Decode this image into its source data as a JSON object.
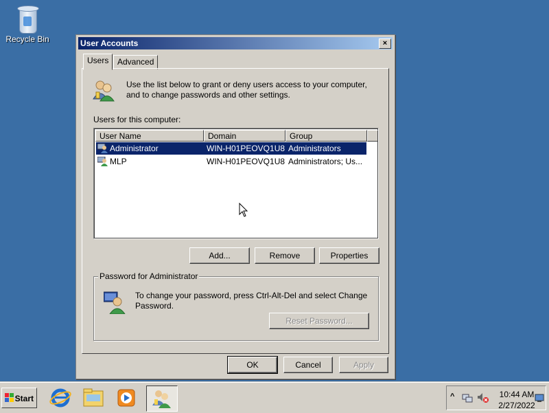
{
  "desktop": {
    "recycle_bin_label": "Recycle Bin"
  },
  "window": {
    "title": "User Accounts",
    "close_glyph": "×",
    "tabs": [
      {
        "label": "Users",
        "active": true
      },
      {
        "label": "Advanced",
        "active": false
      }
    ],
    "intro_text": "Use the list below to grant or deny users access to your computer, and to change passwords and other settings.",
    "users_label": "Users for this computer:",
    "columns": [
      "User Name",
      "Domain",
      "Group"
    ],
    "rows": [
      {
        "name": "Administrator",
        "domain": "WIN-H01PEOVQ1U8",
        "group": "Administrators",
        "selected": true
      },
      {
        "name": "MLP",
        "domain": "WIN-H01PEOVQ1U8",
        "group": "Administrators; Us...",
        "selected": false
      }
    ],
    "buttons": {
      "add": "Add...",
      "remove": "Remove",
      "properties": "Properties"
    },
    "password_group": {
      "title": "Password for Administrator",
      "text": "To change your password, press Ctrl-Alt-Del and select Change Password.",
      "reset_button": "Reset Password..."
    },
    "footer": {
      "ok": "OK",
      "cancel": "Cancel",
      "apply": "Apply"
    }
  },
  "taskbar": {
    "start_label": "Start",
    "pinned": [
      "ie-icon",
      "explorer-icon",
      "media-player-icon",
      "user-accounts-icon"
    ],
    "tray": {
      "time": "10:44 AM",
      "date": "2/27/2022",
      "show_hidden_glyph": "^"
    }
  },
  "colors": {
    "desktop": "#3a6ea5",
    "selection": "#0a246a",
    "face": "#d4d0c8"
  }
}
